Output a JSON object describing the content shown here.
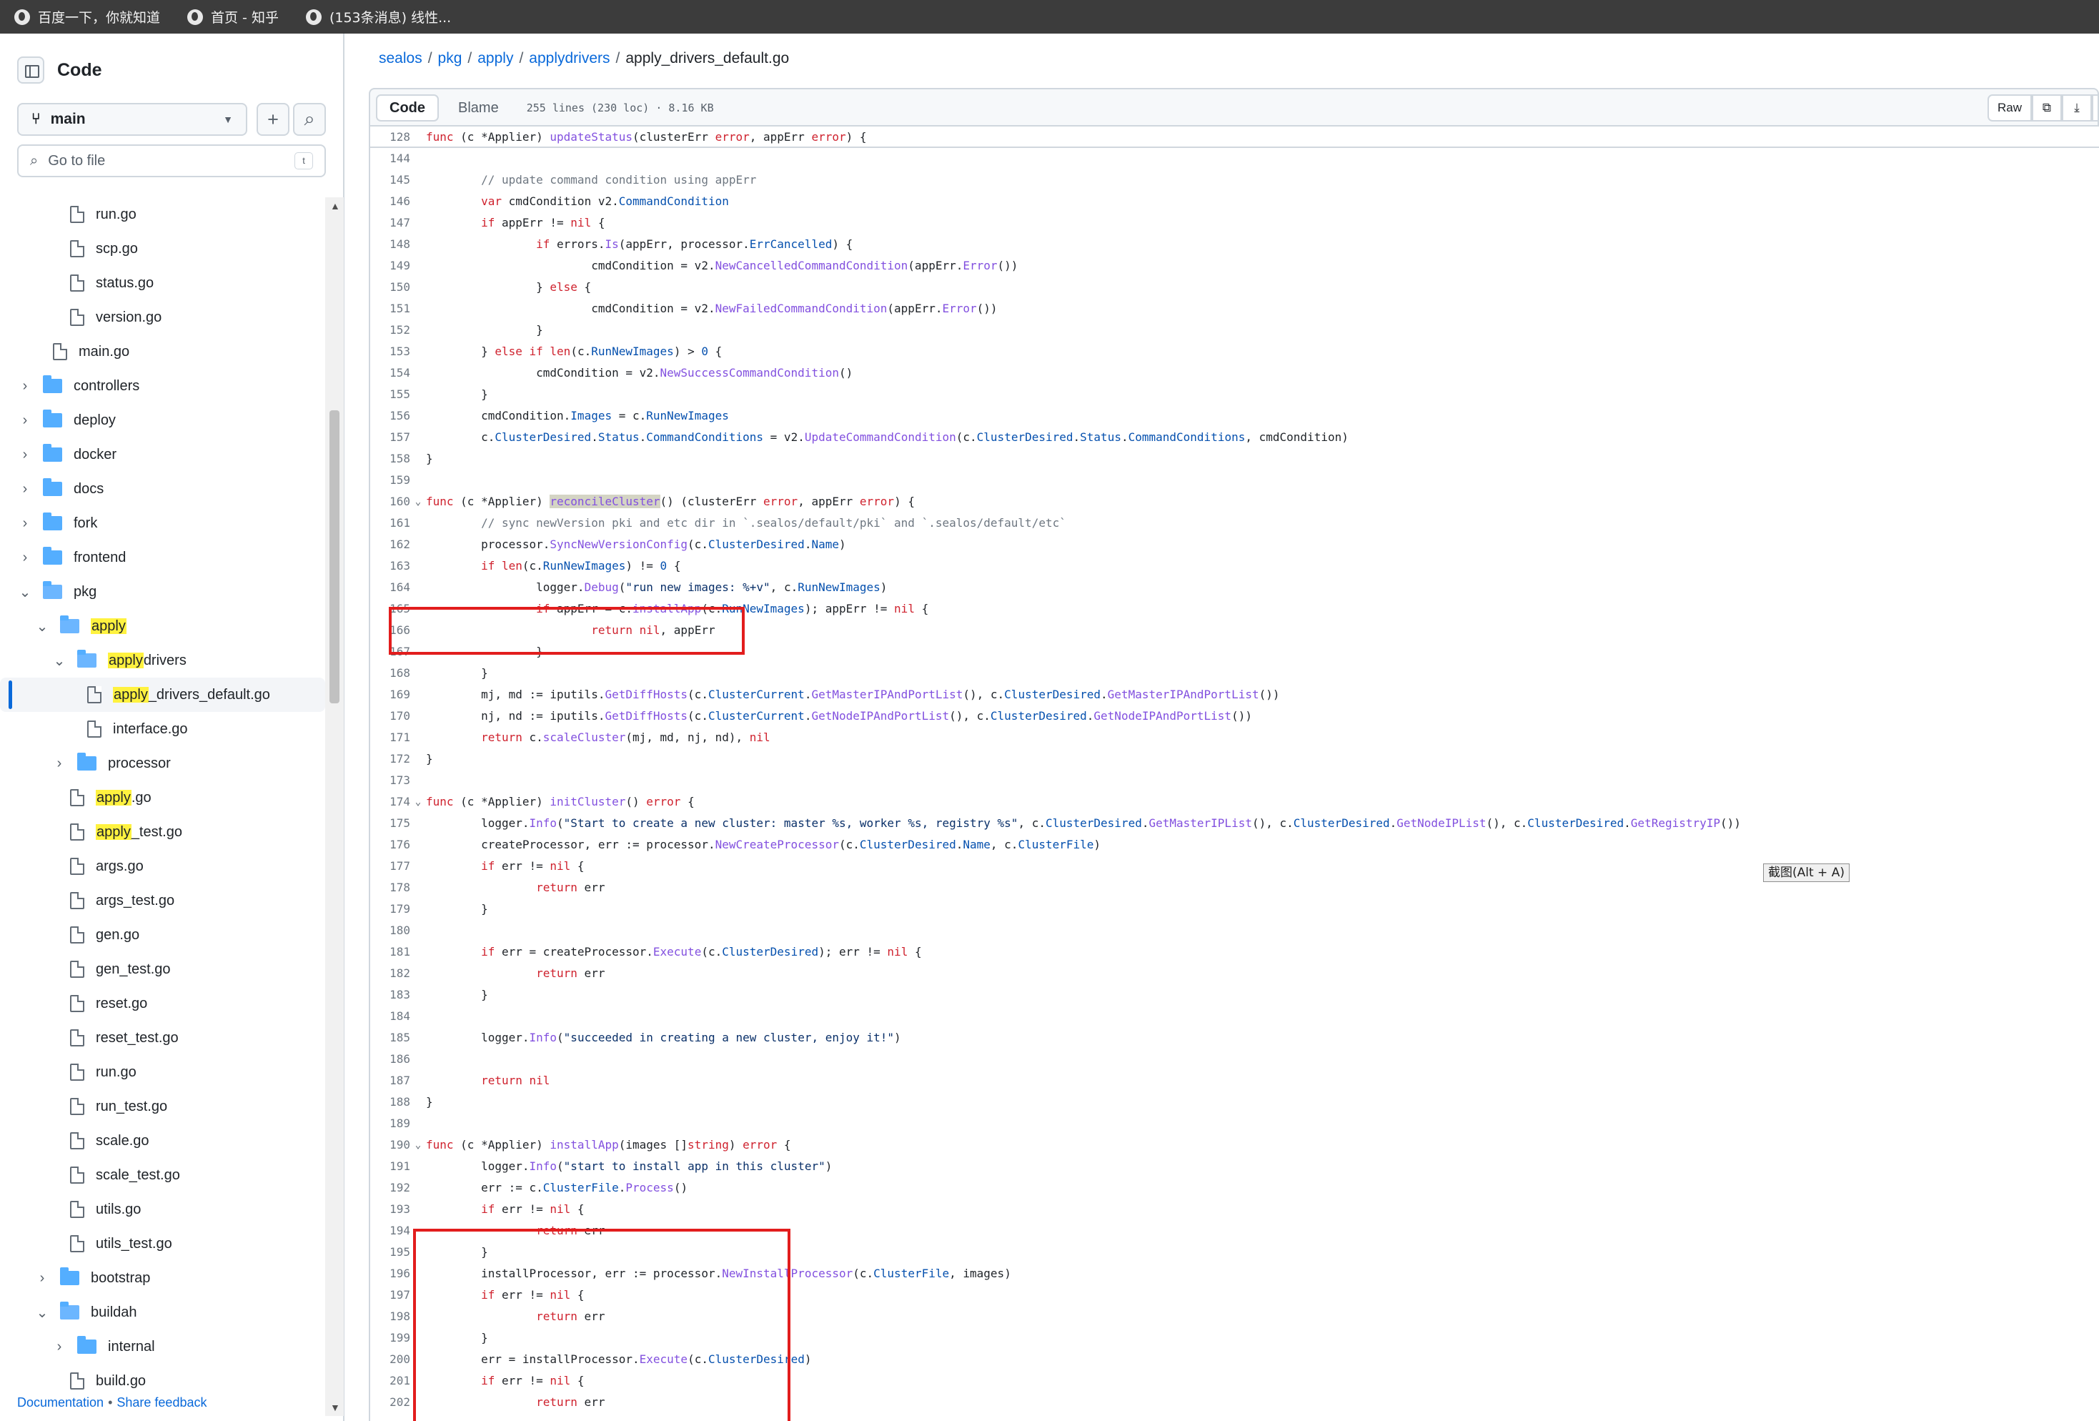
{
  "bookmarks": [
    {
      "label": "百度一下，你就知道"
    },
    {
      "label": "首页 - 知乎"
    },
    {
      "label": "(153条消息) 线性..."
    }
  ],
  "sidebar": {
    "title": "Code",
    "branch": "main",
    "search_placeholder": "Go to file",
    "shortcut": "t",
    "tree": [
      {
        "text": "run.go",
        "type": "file",
        "level": 2
      },
      {
        "text": "scp.go",
        "type": "file",
        "level": 2
      },
      {
        "text": "status.go",
        "type": "file",
        "level": 2
      },
      {
        "text": "version.go",
        "type": "file",
        "level": 2
      },
      {
        "text": "main.go",
        "type": "file",
        "level": 1
      },
      {
        "text": "controllers",
        "type": "folder",
        "level": 0
      },
      {
        "text": "deploy",
        "type": "folder",
        "level": 0
      },
      {
        "text": "docker",
        "type": "folder",
        "level": 0
      },
      {
        "text": "docs",
        "type": "folder",
        "level": 0
      },
      {
        "text": "fork",
        "type": "folder",
        "level": 0
      },
      {
        "text": "frontend",
        "type": "folder",
        "level": 0
      },
      {
        "text": "pkg",
        "type": "folder",
        "level": 0,
        "open": true
      },
      {
        "text": "apply",
        "type": "folder",
        "level": 1,
        "open": true,
        "highlight": "apply"
      },
      {
        "text": "applydrivers",
        "type": "folder",
        "level": 2,
        "open": true,
        "highlight": "apply"
      },
      {
        "text": "apply_drivers_default.go",
        "type": "file",
        "level": 3,
        "selected": true,
        "highlight": "apply"
      },
      {
        "text": "interface.go",
        "type": "file",
        "level": 3
      },
      {
        "text": "processor",
        "type": "folder",
        "level": 2
      },
      {
        "text": "apply.go",
        "type": "file",
        "level": 2,
        "highlight": "apply"
      },
      {
        "text": "apply_test.go",
        "type": "file",
        "level": 2,
        "highlight": "apply"
      },
      {
        "text": "args.go",
        "type": "file",
        "level": 2
      },
      {
        "text": "args_test.go",
        "type": "file",
        "level": 2
      },
      {
        "text": "gen.go",
        "type": "file",
        "level": 2
      },
      {
        "text": "gen_test.go",
        "type": "file",
        "level": 2
      },
      {
        "text": "reset.go",
        "type": "file",
        "level": 2
      },
      {
        "text": "reset_test.go",
        "type": "file",
        "level": 2
      },
      {
        "text": "run.go",
        "type": "file",
        "level": 2
      },
      {
        "text": "run_test.go",
        "type": "file",
        "level": 2
      },
      {
        "text": "scale.go",
        "type": "file",
        "level": 2
      },
      {
        "text": "scale_test.go",
        "type": "file",
        "level": 2
      },
      {
        "text": "utils.go",
        "type": "file",
        "level": 2
      },
      {
        "text": "utils_test.go",
        "type": "file",
        "level": 2
      },
      {
        "text": "bootstrap",
        "type": "folder",
        "level": 1
      },
      {
        "text": "buildah",
        "type": "folder",
        "level": 1,
        "open": true
      },
      {
        "text": "internal",
        "type": "folder",
        "level": 2
      },
      {
        "text": "build.go",
        "type": "file",
        "level": 2
      }
    ],
    "footer": {
      "doc": "Documentation",
      "sep": "•",
      "feedback": "Share feedback"
    }
  },
  "breadcrumb": [
    "sealos",
    "pkg",
    "apply",
    "applydrivers",
    "apply_drivers_default.go"
  ],
  "filebar": {
    "tabs": [
      "Code",
      "Blame"
    ],
    "meta": "255 lines (230 loc) · 8.16 KB",
    "raw": "Raw"
  },
  "sticky": {
    "number": "128",
    "text": "func (c *Applier) updateStatus(clusterErr error, appErr error) {"
  },
  "code": [
    {
      "n": "144",
      "t": ""
    },
    {
      "n": "145",
      "t": "        // update command condition using appErr"
    },
    {
      "n": "146",
      "t": "        var cmdCondition v2.CommandCondition"
    },
    {
      "n": "147",
      "t": "        if appErr != nil {"
    },
    {
      "n": "148",
      "t": "                if errors.Is(appErr, processor.ErrCancelled) {"
    },
    {
      "n": "149",
      "t": "                        cmdCondition = v2.NewCancelledCommandCondition(appErr.Error())"
    },
    {
      "n": "150",
      "t": "                } else {"
    },
    {
      "n": "151",
      "t": "                        cmdCondition = v2.NewFailedCommandCondition(appErr.Error())"
    },
    {
      "n": "152",
      "t": "                }"
    },
    {
      "n": "153",
      "t": "        } else if len(c.RunNewImages) > 0 {"
    },
    {
      "n": "154",
      "t": "                cmdCondition = v2.NewSuccessCommandCondition()"
    },
    {
      "n": "155",
      "t": "        }"
    },
    {
      "n": "156",
      "t": "        cmdCondition.Images = c.RunNewImages"
    },
    {
      "n": "157",
      "t": "        c.ClusterDesired.Status.CommandConditions = v2.UpdateCommandCondition(c.ClusterDesired.Status.CommandConditions, cmdCondition)"
    },
    {
      "n": "158",
      "t": "}"
    },
    {
      "n": "159",
      "t": ""
    },
    {
      "n": "160",
      "t": "func (c *Applier) reconcileCluster() (clusterErr error, appErr error) {",
      "fold": true
    },
    {
      "n": "161",
      "t": "        // sync newVersion pki and etc dir in `.sealos/default/pki` and `.sealos/default/etc`"
    },
    {
      "n": "162",
      "t": "        processor.SyncNewVersionConfig(c.ClusterDesired.Name)"
    },
    {
      "n": "163",
      "t": "        if len(c.RunNewImages) != 0 {"
    },
    {
      "n": "164",
      "t": "                logger.Debug(\"run new images: %+v\", c.RunNewImages)"
    },
    {
      "n": "165",
      "t": "                if appErr = c.installApp(c.RunNewImages); appErr != nil {"
    },
    {
      "n": "166",
      "t": "                        return nil, appErr"
    },
    {
      "n": "167",
      "t": "                }"
    },
    {
      "n": "168",
      "t": "        }"
    },
    {
      "n": "169",
      "t": "        mj, md := iputils.GetDiffHosts(c.ClusterCurrent.GetMasterIPAndPortList(), c.ClusterDesired.GetMasterIPAndPortList())"
    },
    {
      "n": "170",
      "t": "        nj, nd := iputils.GetDiffHosts(c.ClusterCurrent.GetNodeIPAndPortList(), c.ClusterDesired.GetNodeIPAndPortList())"
    },
    {
      "n": "171",
      "t": "        return c.scaleCluster(mj, md, nj, nd), nil"
    },
    {
      "n": "172",
      "t": "}"
    },
    {
      "n": "173",
      "t": ""
    },
    {
      "n": "174",
      "t": "func (c *Applier) initCluster() error {",
      "fold": true
    },
    {
      "n": "175",
      "t": "        logger.Info(\"Start to create a new cluster: master %s, worker %s, registry %s\", c.ClusterDesired.GetMasterIPList(), c.ClusterDesired.GetNodeIPList(), c.ClusterDesired.GetRegistryIP())"
    },
    {
      "n": "176",
      "t": "        createProcessor, err := processor.NewCreateProcessor(c.ClusterDesired.Name, c.ClusterFile)"
    },
    {
      "n": "177",
      "t": "        if err != nil {"
    },
    {
      "n": "178",
      "t": "                return err"
    },
    {
      "n": "179",
      "t": "        }"
    },
    {
      "n": "180",
      "t": ""
    },
    {
      "n": "181",
      "t": "        if err = createProcessor.Execute(c.ClusterDesired); err != nil {"
    },
    {
      "n": "182",
      "t": "                return err"
    },
    {
      "n": "183",
      "t": "        }"
    },
    {
      "n": "184",
      "t": ""
    },
    {
      "n": "185",
      "t": "        logger.Info(\"succeeded in creating a new cluster, enjoy it!\")"
    },
    {
      "n": "186",
      "t": ""
    },
    {
      "n": "187",
      "t": "        return nil"
    },
    {
      "n": "188",
      "t": "}"
    },
    {
      "n": "189",
      "t": ""
    },
    {
      "n": "190",
      "t": "func (c *Applier) installApp(images []string) error {",
      "fold": true
    },
    {
      "n": "191",
      "t": "        logger.Info(\"start to install app in this cluster\")"
    },
    {
      "n": "192",
      "t": "        err := c.ClusterFile.Process()"
    },
    {
      "n": "193",
      "t": "        if err != nil {"
    },
    {
      "n": "194",
      "t": "                return err"
    },
    {
      "n": "195",
      "t": "        }"
    },
    {
      "n": "196",
      "t": "        installProcessor, err := processor.NewInstallProcessor(c.ClusterFile, images)"
    },
    {
      "n": "197",
      "t": "        if err != nil {"
    },
    {
      "n": "198",
      "t": "                return err"
    },
    {
      "n": "199",
      "t": "        }"
    },
    {
      "n": "200",
      "t": "        err = installProcessor.Execute(c.ClusterDesired)"
    },
    {
      "n": "201",
      "t": "        if err != nil {"
    },
    {
      "n": "202",
      "t": "                return err"
    }
  ],
  "tooltip": "截图(Alt + A)",
  "colors": {
    "keyword": "#cf222e",
    "function": "#8250df",
    "string": "#0a3069",
    "comment": "#6e7781",
    "annotation": "#e21d1d"
  }
}
